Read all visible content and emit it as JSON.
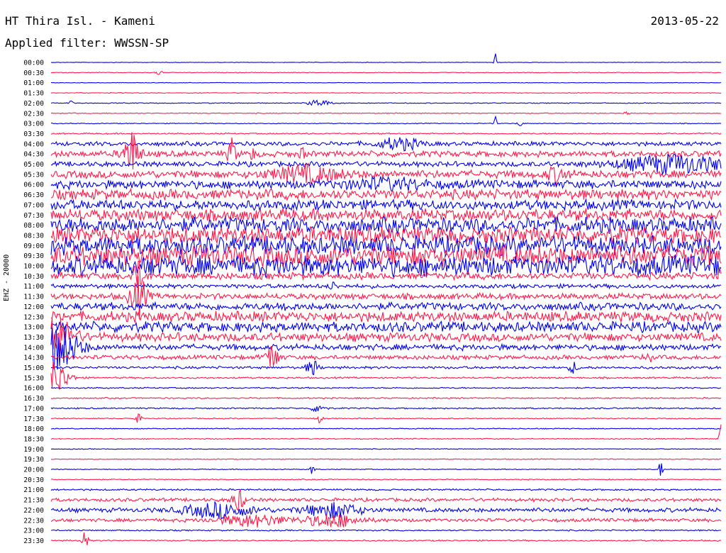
{
  "header": {
    "station": "HT Thira Isl. - Kameni",
    "date": "2013-05-22",
    "filter": "Applied filter: WWSSN-SP"
  },
  "channel_label": "EHZ - 20000",
  "colors": {
    "trace_a": "#0000ee",
    "trace_b": "#ff1a4a",
    "background": "#ffffff",
    "text": "#000000"
  },
  "chart_data": {
    "type": "line",
    "subtype": "helicorder",
    "title": "HT Thira Isl. - Kameni",
    "date": "2013-05-22",
    "filter": "WWSSN-SP",
    "ylabel": "EHZ - 20000",
    "xlabel": "",
    "row_interval_minutes": 30,
    "color_cycle": [
      "#0000ee",
      "#ff1a4a"
    ],
    "row_labels": [
      "00:00",
      "00:30",
      "01:00",
      "01:30",
      "02:00",
      "02:30",
      "03:00",
      "03:30",
      "04:00",
      "04:30",
      "05:00",
      "05:30",
      "06:00",
      "06:30",
      "07:00",
      "07:30",
      "08:00",
      "08:30",
      "09:00",
      "09:30",
      "10:00",
      "10:30",
      "11:00",
      "11:30",
      "12:00",
      "12:30",
      "13:00",
      "13:30",
      "14:00",
      "14:30",
      "15:00",
      "15:30",
      "16:00",
      "16:30",
      "17:00",
      "17:30",
      "18:00",
      "18:30",
      "19:00",
      "19:30",
      "20:00",
      "20:30",
      "21:00",
      "21:30",
      "22:00",
      "22:30",
      "23:00",
      "23:30"
    ],
    "noise_amplitude": [
      0.3,
      0.4,
      0.3,
      0.4,
      0.5,
      0.5,
      0.5,
      0.8,
      2.5,
      3.5,
      3.0,
      4.5,
      5.0,
      6.0,
      6.0,
      7.0,
      9.0,
      10.0,
      11.0,
      12.0,
      12.0,
      4.0,
      2.5,
      3.5,
      4.5,
      6.0,
      6.0,
      5.0,
      3.5,
      2.5,
      1.5,
      1.0,
      0.8,
      0.8,
      0.8,
      0.6,
      0.6,
      0.6,
      0.5,
      0.5,
      0.5,
      0.6,
      1.0,
      2.0,
      2.5,
      2.0,
      0.8,
      0.8
    ],
    "events": [
      {
        "row": 1,
        "x": 0.16,
        "amp": 3,
        "width": 0.006
      },
      {
        "row": 0,
        "x": 0.663,
        "amp": 14,
        "width": 0.002
      },
      {
        "row": 4,
        "x": 0.4,
        "amp": 5,
        "width": 0.015
      },
      {
        "row": 4,
        "x": 0.03,
        "amp": 3,
        "width": 0.005
      },
      {
        "row": 5,
        "x": 0.86,
        "amp": 3,
        "width": 0.005
      },
      {
        "row": 6,
        "x": 0.663,
        "amp": 10,
        "width": 0.002
      },
      {
        "row": 6,
        "x": 0.7,
        "amp": 4,
        "width": 0.004
      },
      {
        "row": 8,
        "x": 0.52,
        "amp": 8,
        "width": 0.03
      },
      {
        "row": 9,
        "x": 0.12,
        "amp": 30,
        "width": 0.012
      },
      {
        "row": 9,
        "x": 0.27,
        "amp": 20,
        "width": 0.006
      },
      {
        "row": 9,
        "x": 0.3,
        "amp": 9,
        "width": 0.004
      },
      {
        "row": 9,
        "x": 0.375,
        "amp": 8,
        "width": 0.004
      },
      {
        "row": 10,
        "x": 0.93,
        "amp": 12,
        "width": 0.08
      },
      {
        "row": 11,
        "x": 0.755,
        "amp": 9,
        "width": 0.015
      },
      {
        "row": 11,
        "x": 0.38,
        "amp": 10,
        "width": 0.05
      },
      {
        "row": 12,
        "x": 0.5,
        "amp": 6,
        "width": 0.06
      },
      {
        "row": 21,
        "x": 0.13,
        "amp": 18,
        "width": 0.01
      },
      {
        "row": 21,
        "x": 1.0,
        "amp": 16,
        "width": 0.004
      },
      {
        "row": 22,
        "x": 0.42,
        "amp": 6,
        "width": 0.005
      },
      {
        "row": 23,
        "x": 0.13,
        "amp": 28,
        "width": 0.012
      },
      {
        "row": 24,
        "x": 0.35,
        "amp": 8,
        "width": 0.005
      },
      {
        "row": 27,
        "x": 0.005,
        "amp": 30,
        "width": 0.025
      },
      {
        "row": 28,
        "x": 0.01,
        "amp": 32,
        "width": 0.03
      },
      {
        "row": 29,
        "x": 0.33,
        "amp": 18,
        "width": 0.01
      },
      {
        "row": 29,
        "x": 0.89,
        "amp": 8,
        "width": 0.006
      },
      {
        "row": 30,
        "x": 0.39,
        "amp": 12,
        "width": 0.008
      },
      {
        "row": 30,
        "x": 0.78,
        "amp": 8,
        "width": 0.006
      },
      {
        "row": 31,
        "x": 0.005,
        "amp": 25,
        "width": 0.02
      },
      {
        "row": 34,
        "x": 0.4,
        "amp": 7,
        "width": 0.01
      },
      {
        "row": 35,
        "x": 0.13,
        "amp": 6,
        "width": 0.005
      },
      {
        "row": 35,
        "x": 0.4,
        "amp": 6,
        "width": 0.005
      },
      {
        "row": 37,
        "x": 1.0,
        "amp": 20,
        "width": 0.004
      },
      {
        "row": 40,
        "x": 0.39,
        "amp": 9,
        "width": 0.003
      },
      {
        "row": 40,
        "x": 0.91,
        "amp": 12,
        "width": 0.003
      },
      {
        "row": 43,
        "x": 0.28,
        "amp": 14,
        "width": 0.01
      },
      {
        "row": 44,
        "x": 0.25,
        "amp": 10,
        "width": 0.05
      },
      {
        "row": 44,
        "x": 0.42,
        "amp": 10,
        "width": 0.04
      },
      {
        "row": 45,
        "x": 0.3,
        "amp": 8,
        "width": 0.05
      },
      {
        "row": 45,
        "x": 0.42,
        "amp": 9,
        "width": 0.04
      },
      {
        "row": 47,
        "x": 0.05,
        "amp": 12,
        "width": 0.005
      }
    ]
  }
}
